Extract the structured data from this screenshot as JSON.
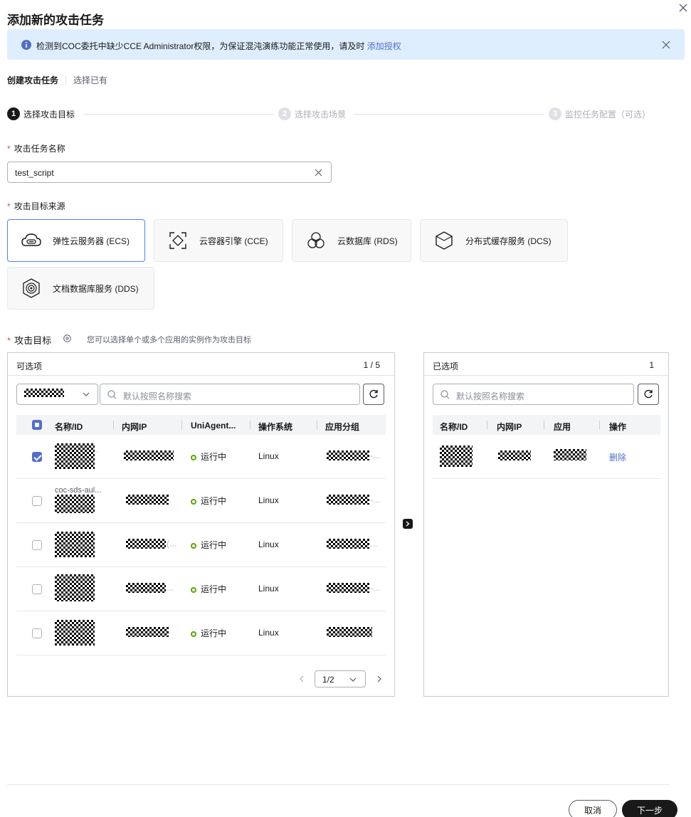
{
  "dialog": {
    "title": "添加新的攻击任务",
    "alert_text": "检测到COC委托中缺少CCE Administrator权限，为保证混沌演练功能正常使用，请及时",
    "alert_link": "添加授权"
  },
  "mode_tabs": {
    "create": "创建攻击任务",
    "select_existing": "选择已有"
  },
  "steps": [
    {
      "num": "1",
      "label": "选择攻击目标"
    },
    {
      "num": "2",
      "label": "选择攻击场景"
    },
    {
      "num": "3",
      "label": "监控任务配置（可选）"
    }
  ],
  "form": {
    "task_name_label": "攻击任务名称",
    "task_name_value": "test_script",
    "source_label": "攻击目标来源",
    "target_label": "攻击目标",
    "target_hint": "您可以选择单个或多个应用的实例作为攻击目标"
  },
  "sources": [
    {
      "label": "弹性云服务器 (ECS)",
      "icon": "ecs-icon",
      "selected": true
    },
    {
      "label": "云容器引擎 (CCE)",
      "icon": "cce-icon",
      "selected": false
    },
    {
      "label": "云数据库 (RDS)",
      "icon": "rds-icon",
      "selected": false
    },
    {
      "label": "分布式缓存服务 (DCS)",
      "icon": "dcs-icon",
      "selected": false
    },
    {
      "label": "文档数据库服务 (DDS)",
      "icon": "dds-icon",
      "selected": false
    }
  ],
  "available": {
    "title": "可选项",
    "count": "1 / 5",
    "search_placeholder": "默认按照名称搜索",
    "columns": [
      "名称/ID",
      "内网IP",
      "UniAgent...",
      "操作系统",
      "应用分组"
    ],
    "rows": [
      {
        "checked": true,
        "status": "运行中",
        "os": "Linux"
      },
      {
        "checked": false,
        "name_visible": "coc-sds-aul...",
        "status": "运行中",
        "os": "Linux"
      },
      {
        "checked": false,
        "status": "运行中",
        "os": "Linux"
      },
      {
        "checked": false,
        "status": "运行中",
        "os": "Linux"
      },
      {
        "checked": false,
        "status": "运行中",
        "os": "Linux"
      }
    ],
    "page": "1/2"
  },
  "selected": {
    "title": "已选项",
    "count": "1",
    "search_placeholder": "默认按照名称搜索",
    "columns": [
      "名称/ID",
      "内网IP",
      "应用",
      "操作"
    ],
    "rows": [
      {
        "action": "删除"
      }
    ]
  },
  "footer": {
    "cancel": "取消",
    "next": "下一步"
  }
}
